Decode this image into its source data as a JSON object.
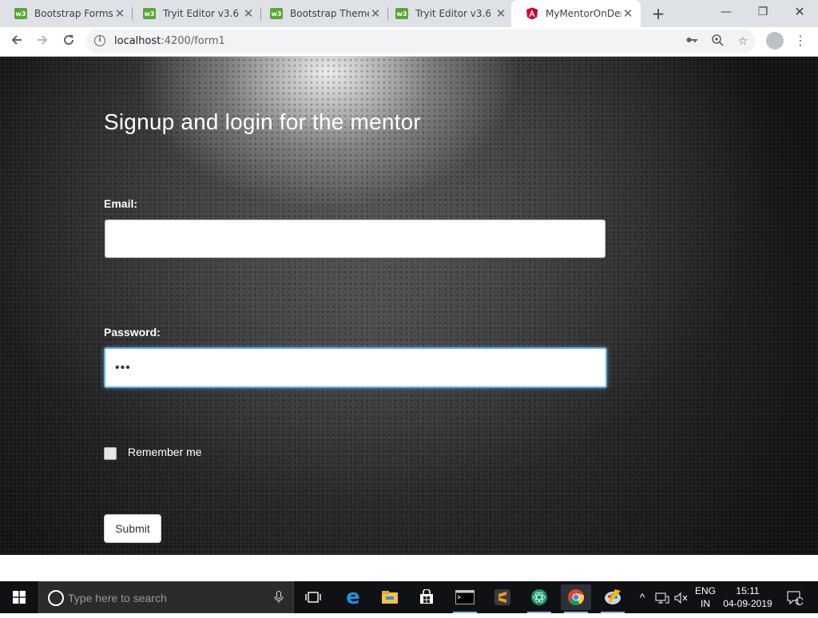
{
  "browser": {
    "tabs": [
      {
        "title": "Bootstrap Forms",
        "favicon": "w3",
        "active": false
      },
      {
        "title": "Tryit Editor v3.6",
        "favicon": "w3",
        "active": false
      },
      {
        "title": "Bootstrap Theme",
        "favicon": "w3",
        "active": false
      },
      {
        "title": "Tryit Editor v3.6",
        "favicon": "w3",
        "active": false
      },
      {
        "title": "MyMentorOnDem",
        "favicon": "angular-icon",
        "active": true
      }
    ],
    "url_host": "localhost",
    "url_rest": ":4200/form1",
    "icons": {
      "back": "arrow-left-icon",
      "forward": "arrow-right-icon",
      "reload": "reload-icon",
      "key": "key-icon",
      "zoom": "zoom-icon",
      "bookmark": "star-icon",
      "menu": "more-vert-icon"
    }
  },
  "page": {
    "heading": "Signup and login for the mentor",
    "email_label": "Email:",
    "email_value": "",
    "password_label": "Password:",
    "password_value": "•••",
    "remember_label": "Remember me",
    "submit_label": "Submit"
  },
  "taskbar": {
    "search_placeholder": "Type here to search",
    "language": "ENG",
    "region": "IN",
    "time": "15:11",
    "date": "04-09-2019",
    "notification_count": "1",
    "accent": "#0078d7"
  }
}
